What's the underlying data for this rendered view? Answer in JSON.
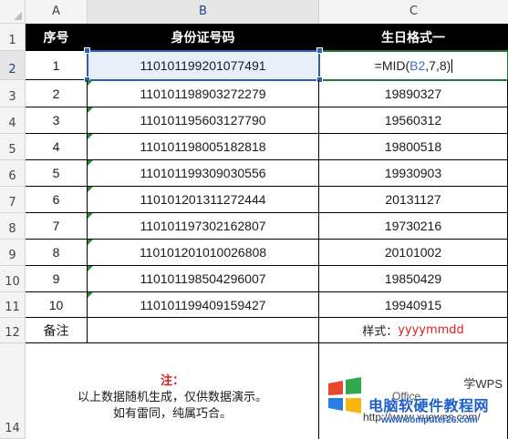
{
  "columns": [
    "A",
    "B",
    "C"
  ],
  "row_numbers": [
    "1",
    "2",
    "3",
    "4",
    "5",
    "6",
    "7",
    "8",
    "9",
    "10",
    "11",
    "12",
    "14"
  ],
  "header": {
    "seq": "序号",
    "id_number": "身份证号码",
    "birthday_format": "生日格式一"
  },
  "active_cell": {
    "formula_prefix": "=MID(",
    "formula_ref": "B2",
    "formula_suffix": ",7,8)"
  },
  "rows": [
    {
      "seq": "1",
      "id": "110101199201077491",
      "birthday": ""
    },
    {
      "seq": "2",
      "id": "110101198903272279",
      "birthday": "19890327"
    },
    {
      "seq": "3",
      "id": "110101195603127790",
      "birthday": "19560312"
    },
    {
      "seq": "4",
      "id": "110101198005182818",
      "birthday": "19800518"
    },
    {
      "seq": "5",
      "id": "110101199309030556",
      "birthday": "19930903"
    },
    {
      "seq": "6",
      "id": "110101201311272444",
      "birthday": "20131127"
    },
    {
      "seq": "7",
      "id": "110101197302162807",
      "birthday": "19730216"
    },
    {
      "seq": "8",
      "id": "110101201010026808",
      "birthday": "20101002"
    },
    {
      "seq": "9",
      "id": "110101198504296007",
      "birthday": "19850429"
    },
    {
      "seq": "10",
      "id": "110101199409159427",
      "birthday": "19940915"
    }
  ],
  "remark_row": {
    "label": "备注",
    "style_label": "样式：",
    "style_value": "yyyymmdd"
  },
  "note": {
    "title": "注：",
    "line1": "以上数据随机生成，仅供数据演示。",
    "line2": "如有雷同，纯属巧合。"
  },
  "watermark": {
    "text_top": "学WPS",
    "text_mid": "电脑软硬件教程网",
    "text_url": "www.computer26.com",
    "text_back": "http://www.xuewps.com/",
    "text_office": "Office"
  },
  "colors": {
    "header_bg": "#000000",
    "selection": "#2e5fb5",
    "edit_border": "#1f7a34",
    "note_red": "#d81e1e",
    "style_red": "#e02020",
    "watermark_blue": "#1e5fc8"
  }
}
